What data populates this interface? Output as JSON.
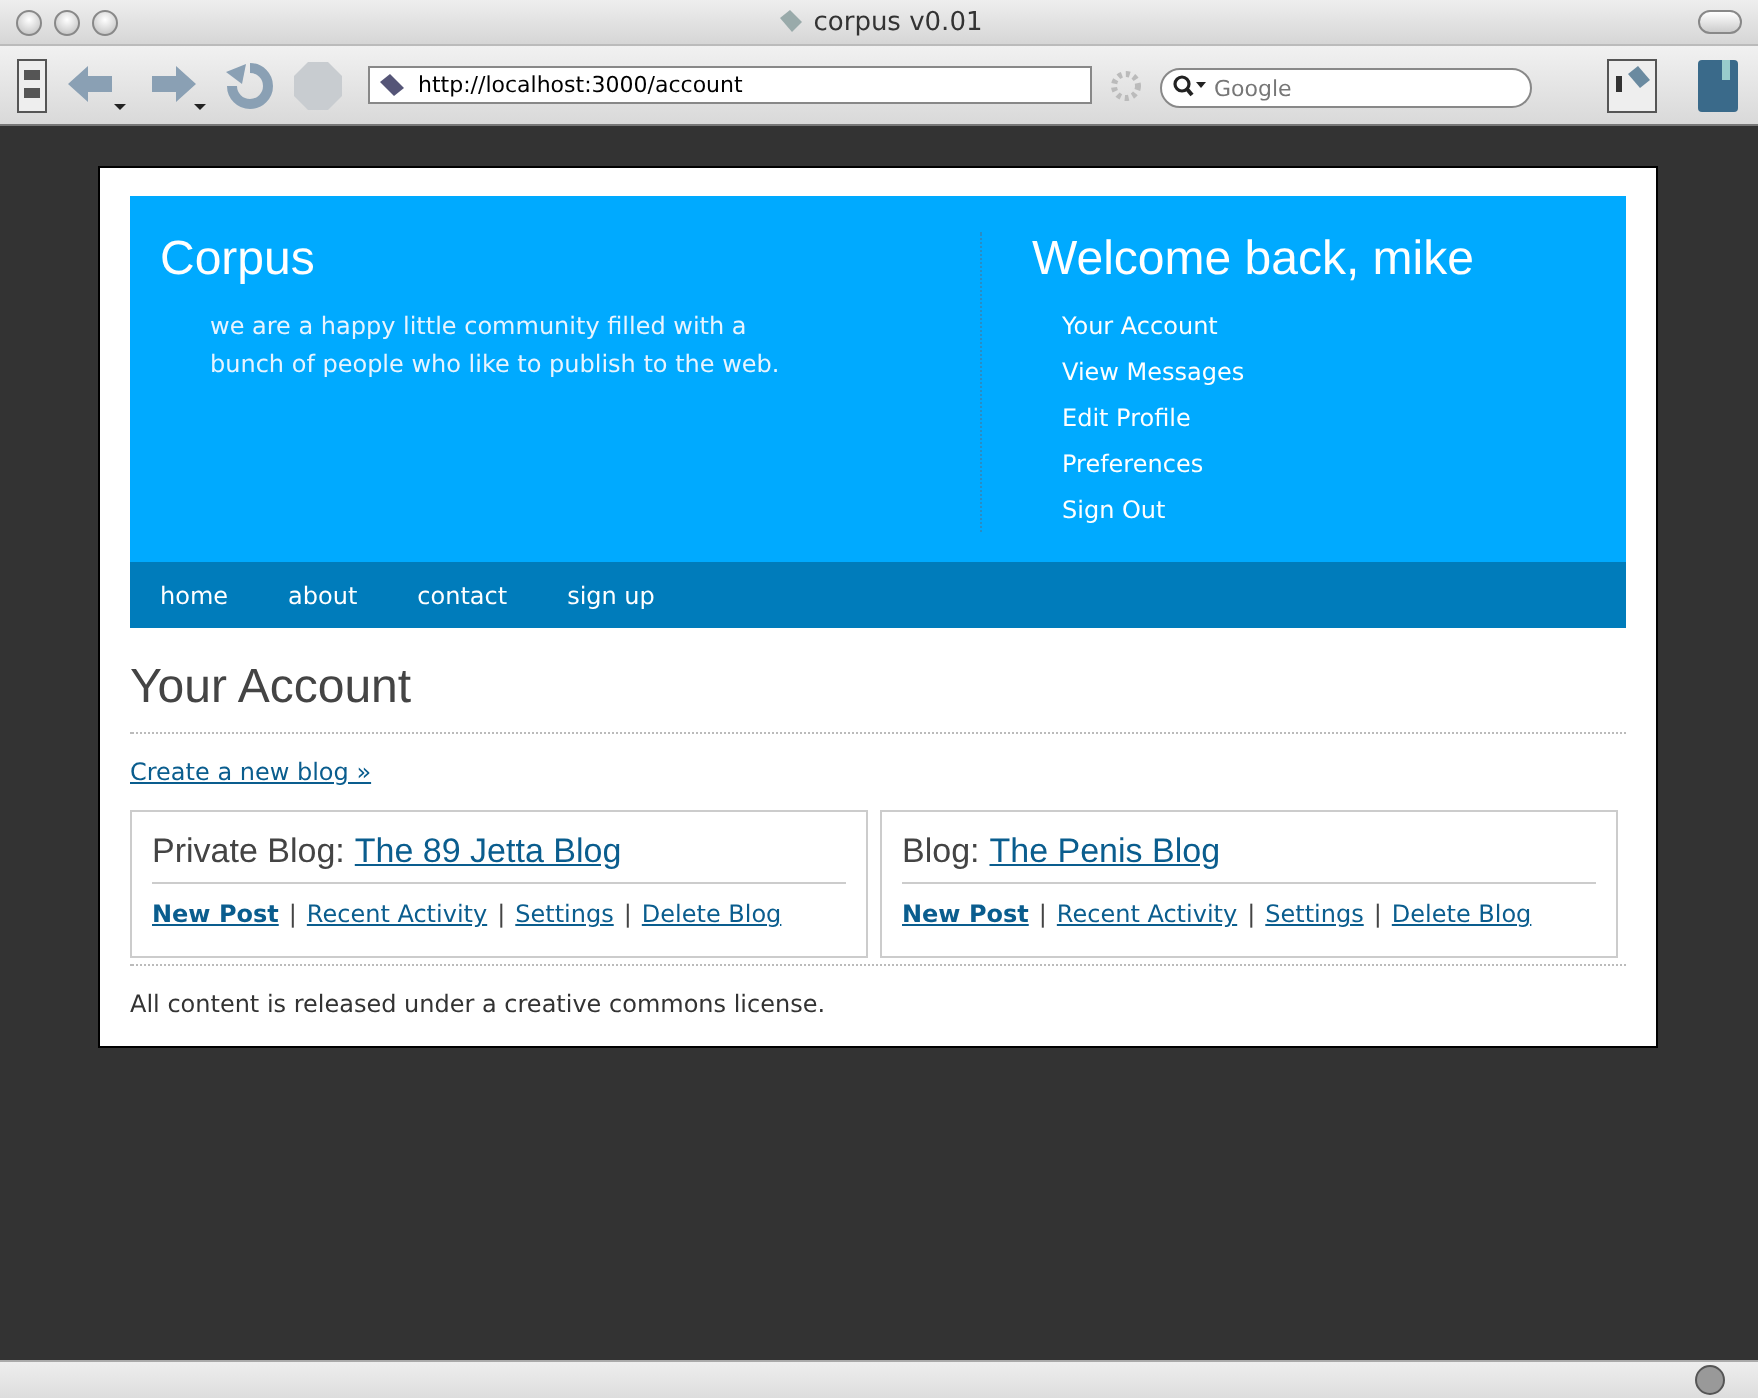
{
  "window": {
    "title": "corpus v0.01"
  },
  "toolbar": {
    "url": "http://localhost:3000/account",
    "search": {
      "placeholder": "Google"
    }
  },
  "header": {
    "site_title": "Corpus",
    "tagline": "we are a happy little community filled with a bunch of people who like to publish to the web.",
    "welcome": "Welcome back, mike",
    "user_links": [
      "Your Account",
      "View Messages",
      "Edit Profile",
      "Preferences",
      "Sign Out"
    ]
  },
  "nav": [
    "home",
    "about",
    "contact",
    "sign up"
  ],
  "page": {
    "heading": "Your Account",
    "create_link": "Create a new blog »",
    "blogs": [
      {
        "label": "Private Blog:",
        "name": "The 89 Jetta Blog",
        "actions": [
          {
            "label": "New Post",
            "bold": true
          },
          {
            "label": "Recent Activity",
            "bold": false
          },
          {
            "label": "Settings",
            "bold": false
          },
          {
            "label": "Delete Blog",
            "bold": false
          }
        ]
      },
      {
        "label": "Blog:",
        "name": "The Penis Blog",
        "actions": [
          {
            "label": "New Post",
            "bold": true
          },
          {
            "label": "Recent Activity",
            "bold": false
          },
          {
            "label": "Settings",
            "bold": false
          },
          {
            "label": "Delete Blog",
            "bold": false
          }
        ]
      }
    ],
    "separator": "|",
    "footer": "All content is released under a creative commons license."
  }
}
